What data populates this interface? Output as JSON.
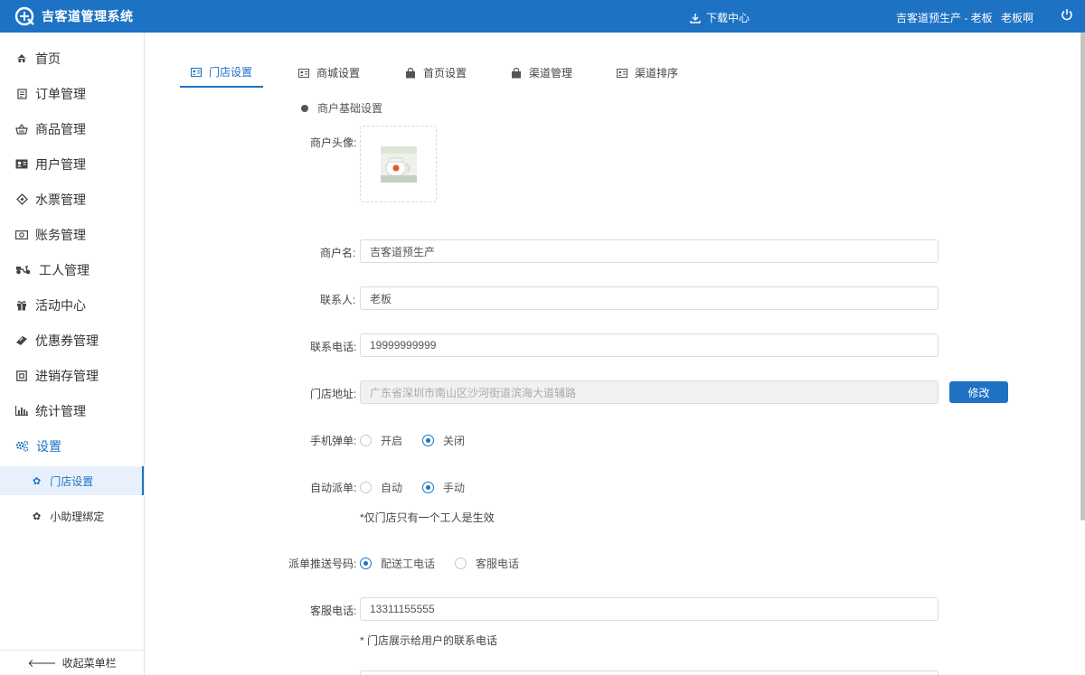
{
  "header": {
    "app_title": "吉客道管理系统",
    "download_label": "下载中心",
    "merchant": "吉客道预生产 - 老板",
    "username": "老板啊"
  },
  "sidebar": {
    "items": [
      {
        "label": "首页",
        "icon": "home-icon"
      },
      {
        "label": "订单管理",
        "icon": "order-icon"
      },
      {
        "label": "商品管理",
        "icon": "basket-icon"
      },
      {
        "label": "用户管理",
        "icon": "user-card-icon"
      },
      {
        "label": "水票管理",
        "icon": "ticket-icon"
      },
      {
        "label": "账务管理",
        "icon": "money-icon"
      },
      {
        "label": "工人管理",
        "icon": "scooter-icon"
      },
      {
        "label": "活动中心",
        "icon": "gift-icon"
      },
      {
        "label": "优惠券管理",
        "icon": "coupon-icon"
      },
      {
        "label": "进销存管理",
        "icon": "inventory-icon"
      },
      {
        "label": "统计管理",
        "icon": "chart-icon"
      },
      {
        "label": "设置",
        "icon": "gears-icon"
      }
    ],
    "sub_items": [
      {
        "label": "门店设置",
        "icon": "gear-icon"
      },
      {
        "label": "小助理绑定",
        "icon": "gear-icon"
      }
    ],
    "collapse_label": "收起菜单栏"
  },
  "tabs": [
    {
      "label": "门店设置"
    },
    {
      "label": "商城设置"
    },
    {
      "label": "首页设置"
    },
    {
      "label": "渠道管理"
    },
    {
      "label": "渠道排序"
    }
  ],
  "form": {
    "section_title": "商户基础设置",
    "avatar_label": "商户头像:",
    "name_label": "商户名:",
    "name_value": "吉客道预生产",
    "contact_label": "联系人:",
    "contact_value": "老板",
    "phone_label": "联系电话:",
    "phone_value": "19999999999",
    "address_label": "门店地址:",
    "address_value": "广东省深圳市南山区沙河街道滨海大道辅路",
    "modify_label": "修改",
    "mobile_popup_label": "手机弹单:",
    "mobile_popup_on": "开启",
    "mobile_popup_off": "关闭",
    "auto_dispatch_label": "自动派单:",
    "auto_dispatch_auto": "自动",
    "auto_dispatch_manual": "手动",
    "auto_dispatch_hint": "*仅门店只有一个工人是生效",
    "push_number_label": "派单推送号码:",
    "push_number_worker": "配送工电话",
    "push_number_service": "客服电话",
    "service_phone_label": "客服电话:",
    "service_phone_value": "13311155555",
    "service_phone_hint": "* 门店展示给用户的联系电话"
  },
  "colors": {
    "primary": "#1d72c4"
  }
}
